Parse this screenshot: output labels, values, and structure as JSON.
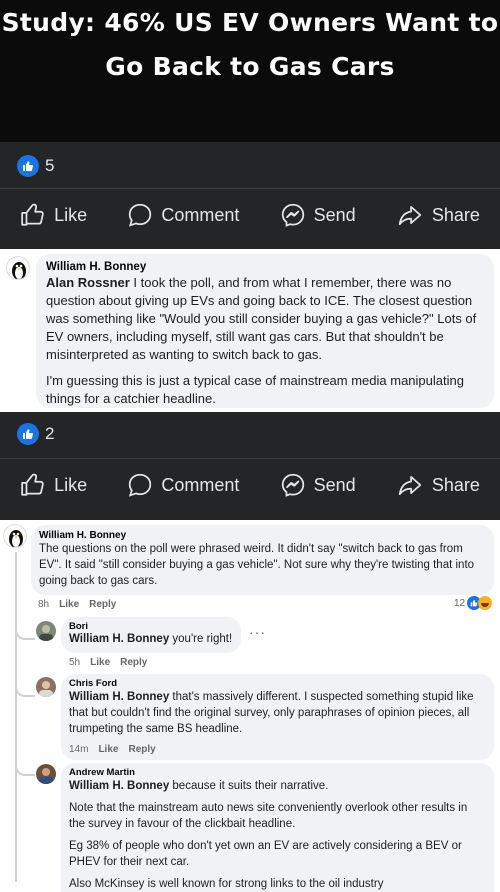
{
  "headline": {
    "line1": "Study: 46% US EV Owners Want to",
    "line2": "Go Back to Gas Cars"
  },
  "post1": {
    "reaction_count": "5",
    "actions": {
      "like": "Like",
      "comment": "Comment",
      "send": "Send",
      "share": "Share"
    }
  },
  "comment1": {
    "author": "William H. Bonney",
    "mention": "Alan Rossner",
    "text": " I took the poll, and from what I remember, there was no question about giving up EVs and going back to ICE. The closest question was something like \"Would you still consider buying a gas vehicle?\" Lots of EV owners, including myself, still want gas cars. But that shouldn't be misinterpreted as wanting to switch back to gas.",
    "text2": "I'm guessing this is just a typical case of mainstream media manipulating things for a catchier headline."
  },
  "post2": {
    "reaction_count": "2",
    "actions": {
      "like": "Like",
      "comment": "Comment",
      "send": "Send",
      "share": "Share"
    }
  },
  "comment2": {
    "author": "William H. Bonney",
    "text": "The questions on the poll were phrased weird. It didn't say \"switch back to gas from EV\". It said \"still consider buying a gas vehicle\". Not sure why they're twisting that into going back to gas cars.",
    "time": "8h",
    "like": "Like",
    "reply": "Reply",
    "reaction_count": "12"
  },
  "reply1": {
    "author": "Bori",
    "mention": "William H. Bonney",
    "text": " you're right!",
    "time": "5h",
    "like": "Like",
    "reply": "Reply",
    "more": "···"
  },
  "reply2": {
    "author": "Chris Ford",
    "mention": "William H. Bonney",
    "text": " that's massively different. I suspected something stupid like that but couldn't find the original survey, only paraphrases of opinion pieces, all trumpeting the same BS headline.",
    "time": "14m",
    "like": "Like",
    "reply": "Reply"
  },
  "reply3": {
    "author": "Andrew Martin",
    "mention": "William H. Bonney",
    "text": " because it suits their narrative.",
    "p2": "Note that the mainstream auto news site conveniently overlook other results in the survey in favour of the clickbait headline.",
    "p3": "Eg 38% of people who don't yet own an EV are actively considering a BEV or PHEV for their next car.",
    "p4": "Also McKinsey is well known for strong links to the oil industry"
  },
  "colors": {
    "fb_blue": "#1b74e4",
    "dark_bg": "#242526",
    "bubble": "#f0f2f5",
    "haha": "#f7b125"
  }
}
